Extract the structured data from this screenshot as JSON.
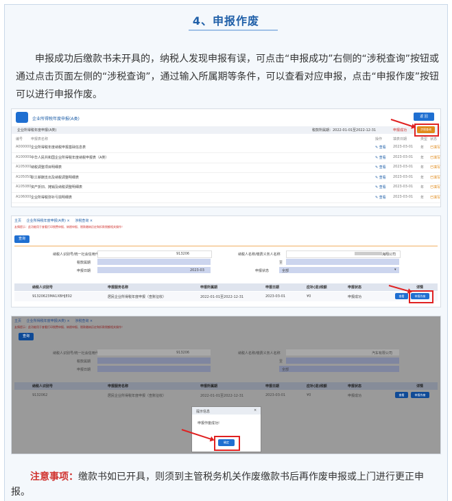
{
  "title": "4、申报作废",
  "intro": "申报成功后缴款书未开具的，纳税人发现申报有误，可点击“申报成功”右侧的“涉税查询”按钮或通过点击页面左侧的“涉税查询”，通过输入所属期等条件，可以查看对应申报，点击“申报作废”按钮可以进行申报作废。",
  "note_label": "注意事项：",
  "note_text": "缴款书如已开具，则须到主管税务机关作废缴款书后再作废申报或上门进行更正申报。",
  "colors": {
    "accent": "#1f5fa8",
    "red": "#d0312d",
    "button": "#1f6fd1"
  },
  "shot1": {
    "header": "企业所得税年度申报(A类)",
    "back_button": "返 回",
    "subtitle": "企业所得税年度申报(A类)",
    "period": "税款所属期：2022-01-01至2022-12-31",
    "status": "申报成功",
    "query_button": "涉税查询",
    "columns": [
      "编号",
      "申报表名称",
      "操作",
      "填表日期",
      "类型",
      "状态"
    ],
    "rows": [
      {
        "code": "A000000",
        "name": "企业所得税年度纳税申报基础信息表",
        "op": "查看",
        "date": "2023-03-01",
        "type": "年",
        "state": "已填写"
      },
      {
        "code": "A100000",
        "name": "中华人民共和国企业所得税年度纳税申报表（A类）",
        "op": "查看",
        "date": "2023-03-01",
        "type": "年",
        "state": "已填写"
      },
      {
        "code": "A105000",
        "name": "纳税调整项目明细表",
        "op": "查看",
        "date": "2023-03-01",
        "type": "年",
        "state": "已填写"
      },
      {
        "code": "A105050",
        "name": "职工薪酬支出及纳税调整明细表",
        "op": "查看",
        "date": "2023-03-01",
        "type": "年",
        "state": "已填写"
      },
      {
        "code": "A105080",
        "name": "资产折旧、摊销及纳税调整明细表",
        "op": "查看",
        "date": "2023-03-01",
        "type": "年",
        "state": "已填写"
      },
      {
        "code": "A106000",
        "name": "企业所得税弥补亏损明细表",
        "op": "查看",
        "date": "2023-03-01",
        "type": "年",
        "state": "已填写"
      }
    ]
  },
  "shot2": {
    "tabs": [
      "主页",
      "企业所得税年度申报(A类) ×",
      "涉税查询 ×"
    ],
    "warning": "友情提示：此功能用于查看打印税费申报、纳税申报、税款缴纳历史和扣款税额相关操作！",
    "query_button": "查询",
    "label_taxid": "纳税人识别号/统一社会信用代码",
    "taxid_value": "913206",
    "label_name": "纳税人名称/缴费义务人名称",
    "name_value": "海翔公司",
    "label_taxtype": "税款属期",
    "label_to": "至",
    "label_date": "申报日期",
    "date_value": "2023-03",
    "label_state": "申报状态",
    "state_value": "全部",
    "columns": [
      "纳税人识别号",
      "申报服务名称",
      "申报所属期",
      "申报日期",
      "应补(退)税额",
      "申报状态",
      "详情"
    ],
    "row": {
      "id": "91320623MA1XBHJE02",
      "service": "居民企业所得税年度申报（查账征收）",
      "period": "2022-01-01至2022-12-31",
      "date": "2023-03-01",
      "amount": "¥0",
      "state": "申报成功"
    },
    "view_button": "查看",
    "void_button": "申报作废"
  },
  "shot3": {
    "tabs": [
      "主页",
      "企业所得税年度申报(A类) ×",
      "涉税查询 ×"
    ],
    "warning": "友情提示：此功能用于查看打印税费申报、纳税申报、税款缴纳历史和扣款税额相关操作！",
    "query_button": "查询",
    "label_taxid": "纳税人识别号/统一社会信用代码",
    "taxid_value": "913206",
    "label_name": "纳税人名称/缴费义务人名称",
    "name_value": "汽车有限公司",
    "label_taxtype": "税款属期",
    "label_to": "至",
    "label_date": "申报日期",
    "state_value": "全部",
    "columns": [
      "纳税人识别号",
      "申报服务名称",
      "申报所属期",
      "申报日期",
      "应补(退)税额",
      "申报状态",
      "详情"
    ],
    "row": {
      "id": "9132062",
      "service": "居民企业所得税年度申报（查账征收）",
      "period": "2022-01-01至2022-12-31",
      "date": "2023-03-01",
      "amount": "¥0",
      "state": "申报成功"
    },
    "view_button": "查看",
    "void_button": "申报作废",
    "dialog_title": "提示信息",
    "dialog_message": "申报作废成功!",
    "dialog_ok": "确定"
  }
}
